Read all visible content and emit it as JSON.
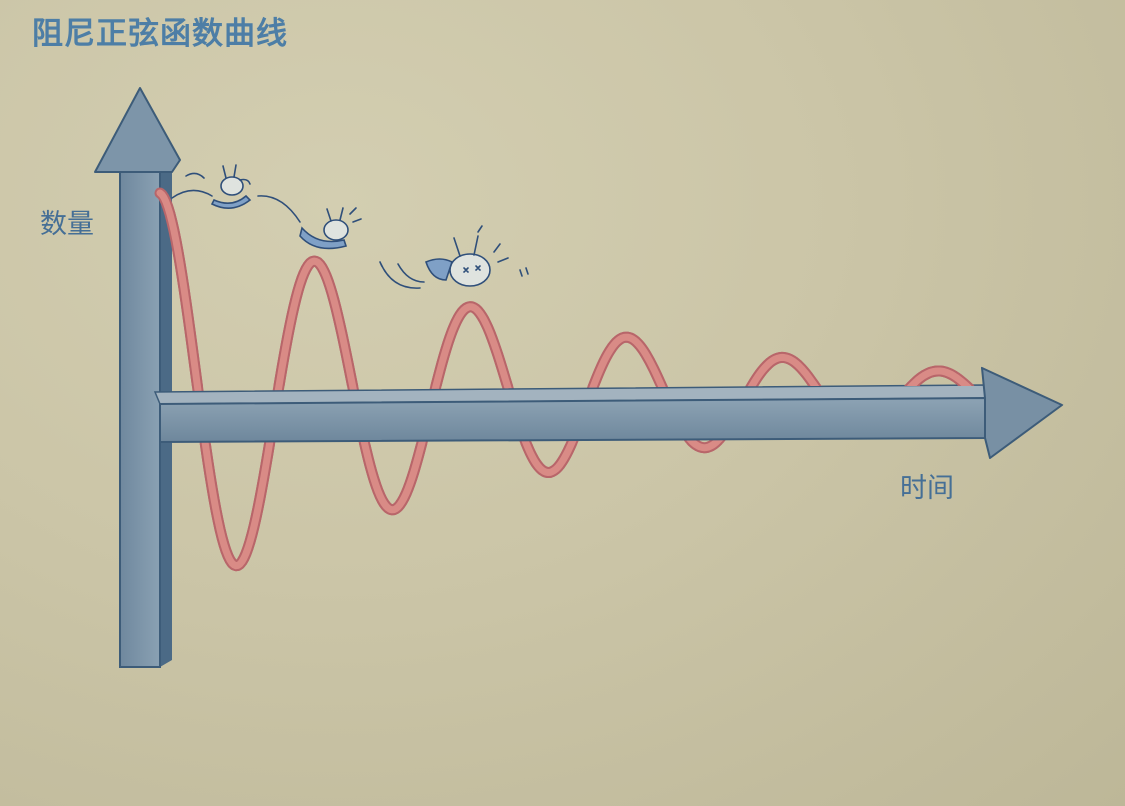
{
  "title": "阻尼正弦函数曲线",
  "y_axis_label": "数量",
  "x_axis_label": "时间",
  "colors": {
    "background": "#cbc5a7",
    "axis_face": "#7e96aa",
    "axis_side": "#4b6a86",
    "axis_outline": "#3d5c79",
    "curve": "#d98b86",
    "curve_edge": "#b8666a",
    "text": "#4d7ea6"
  },
  "illustration": {
    "icons": [
      "rabbit-sliding-icon",
      "rabbit-tumbling-icon",
      "rabbit-dizzy-icon"
    ]
  }
}
